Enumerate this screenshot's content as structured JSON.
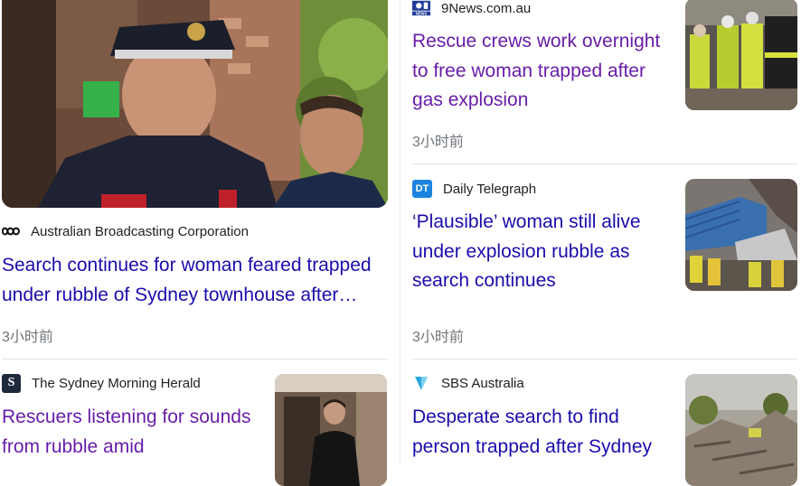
{
  "articles": [
    {
      "source": "Australian Broadcasting Corporation",
      "source_icon": "abc-logo-icon",
      "title": "Search continues for woman feared trapped under rubble of Sydney townhouse after…",
      "time": "3小时前",
      "link_color": "#1a0dab"
    },
    {
      "source": "9News.com.au",
      "source_icon": "9news-logo-icon",
      "title": "Rescue crews work overnight to free woman trapped after gas explosion",
      "time": "3小时前",
      "link_color": "#681da8"
    },
    {
      "source": "Daily Telegraph",
      "source_icon": "daily-telegraph-logo-icon",
      "icon_text": "DT",
      "title": "‘Plausible’ woman still alive under explosion rubble as search continues",
      "time": "3小时前",
      "link_color": "#1a0dab"
    },
    {
      "source": "The Sydney Morning Herald",
      "source_icon": "smh-logo-icon",
      "icon_text": "S",
      "title": "Rescuers listening for sounds from rubble amid",
      "link_color": "#681da8"
    },
    {
      "source": "SBS Australia",
      "source_icon": "sbs-logo-icon",
      "title": "Desperate search to find person trapped after Sydney",
      "link_color": "#1a0dab"
    }
  ]
}
